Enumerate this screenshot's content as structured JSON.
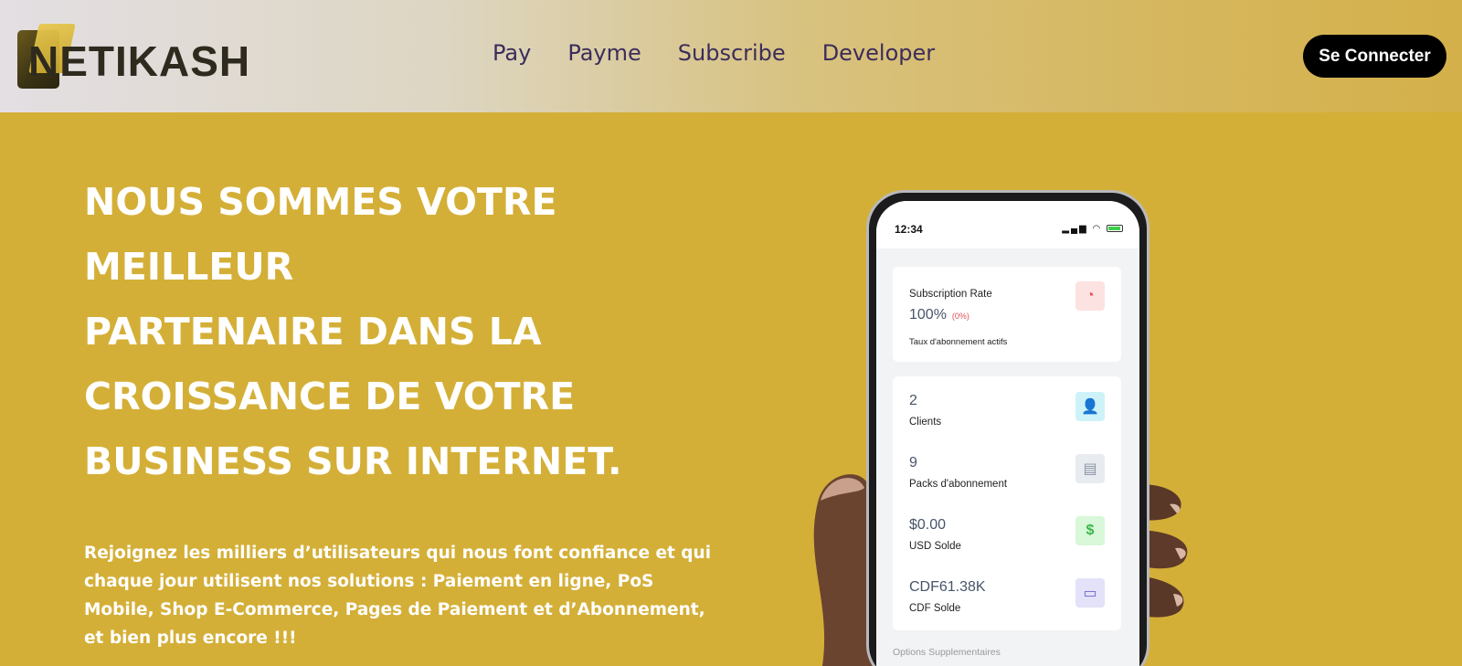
{
  "brand": {
    "name": "NETIKASH"
  },
  "nav": {
    "items": [
      {
        "label": "Pay"
      },
      {
        "label": "Payme"
      },
      {
        "label": "Subscribe"
      },
      {
        "label": "Developer"
      }
    ],
    "login_label": "Se Connecter"
  },
  "hero": {
    "title_lines": [
      "NOUS SOMMES VOTRE MEILLEUR",
      "PARTENAIRE DANS LA",
      "CROISSANCE DE VOTRE",
      "BUSINESS SUR INTERNET."
    ],
    "description": "Rejoignez les milliers d’utilisateurs qui nous font confiance et qui chaque jour utilisent nos solutions : Paiement en ligne, PoS Mobile, Shop E-Commerce, Pages de Paiement et d’Abonnement, et bien plus encore !!!"
  },
  "phone": {
    "time": "12:34",
    "subscription": {
      "label": "Subscription Rate",
      "value": "100%",
      "change": "(0%)",
      "caption": "Taux d'abonnement actifs",
      "icon": "pie-chart-icon"
    },
    "stats": [
      {
        "value": "2",
        "label": "Clients",
        "icon": "user-icon",
        "color": "#cdf3f8"
      },
      {
        "value": "9",
        "label": "Packs d'abonnement",
        "icon": "document-icon",
        "color": "#e8ebef"
      },
      {
        "value": "$0.00",
        "label": "USD Solde",
        "icon": "dollar-icon",
        "color": "#d9f7d9"
      },
      {
        "value": "CDF61.38K",
        "label": "CDF Solde",
        "icon": "wallet-icon",
        "color": "#e3e2f8"
      }
    ],
    "options_label": "Options Supplementaires"
  },
  "colors": {
    "background": "#d4af37",
    "button": "#000000",
    "nav_text": "#3b2d5a"
  }
}
